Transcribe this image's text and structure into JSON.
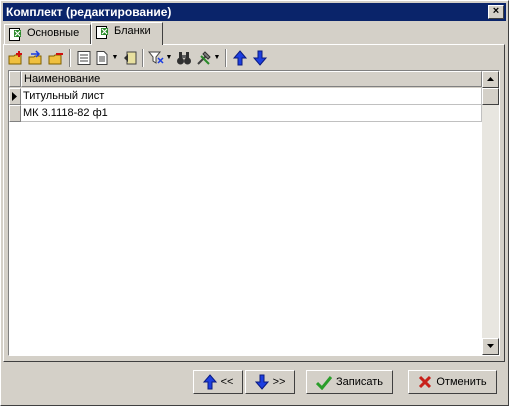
{
  "window": {
    "title": "Комплект (редактирование)",
    "close_glyph": "×"
  },
  "tabs": [
    {
      "label": "Основные",
      "icon": "document-x-icon",
      "active": false
    },
    {
      "label": "Бланки",
      "icon": "document-x-icon",
      "active": true
    }
  ],
  "toolbar": {
    "items": [
      "add-folder-icon",
      "add-sub-folder-icon",
      "remove-folder-icon",
      "properties-icon",
      "document-icon",
      "report-icon",
      "filter-icon",
      "find-binoculars-icon",
      "tools-icon",
      "move-up-icon",
      "move-down-icon"
    ]
  },
  "grid": {
    "column_header": "Наименование",
    "rows": [
      {
        "name": "Титульный лист",
        "current": true
      },
      {
        "name": "МК 3.1118-82 ф1",
        "current": false
      }
    ]
  },
  "buttons": {
    "prev_label": "<<",
    "next_label": ">>",
    "save_label": "Записать",
    "cancel_label": "Отменить"
  },
  "colors": {
    "title_bar": "#0a246a",
    "face": "#d4d0c8",
    "arrow_blue": "#1c3ee0",
    "check_green": "#2a9d2a",
    "cross_red": "#c8201a"
  }
}
